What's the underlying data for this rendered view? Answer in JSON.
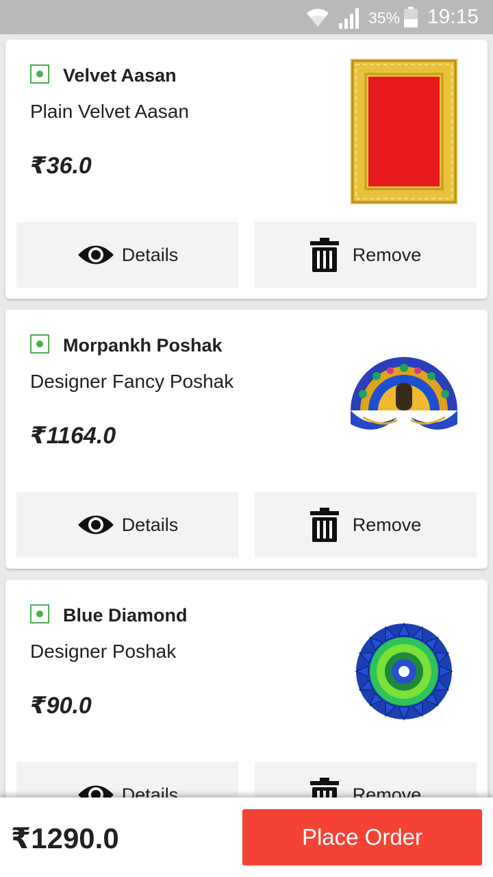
{
  "status_bar": {
    "battery_percent": "35%",
    "time": "19:15",
    "icons": [
      "wifi-icon",
      "signal-icon",
      "battery-icon"
    ]
  },
  "cart": {
    "items": [
      {
        "title": "Velvet Aasan",
        "subtitle": "Plain Velvet Aasan",
        "price": "₹36.0",
        "image": "velvet-aasan-image",
        "details_label": "Details",
        "remove_label": "Remove"
      },
      {
        "title": "Morpankh Poshak",
        "subtitle": "Designer Fancy Poshak",
        "price": "₹1164.0",
        "image": "morpankh-poshak-image",
        "details_label": "Details",
        "remove_label": "Remove"
      },
      {
        "title": "Blue Diamond",
        "subtitle": "Designer Poshak",
        "price": "₹90.0",
        "image": "blue-diamond-image",
        "details_label": "Details",
        "remove_label": "Remove"
      }
    ]
  },
  "footer": {
    "total": "₹1290.0",
    "place_order_label": "Place Order"
  },
  "colors": {
    "accent": "#f44336",
    "veg_green": "#4caf50",
    "status_bar": "#b9b9bb",
    "button_bg": "#f3f3f6"
  }
}
